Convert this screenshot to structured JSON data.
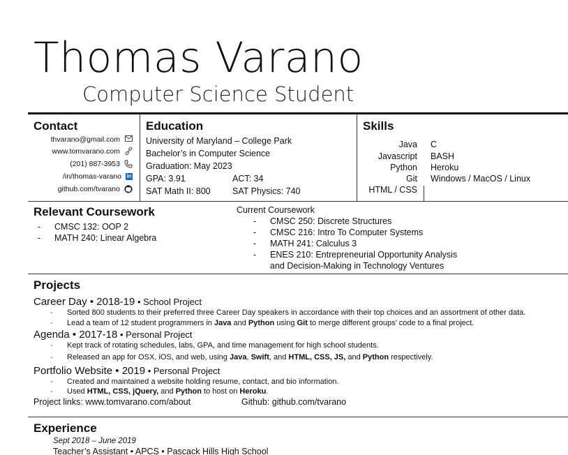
{
  "header": {
    "name": "Thomas Varano",
    "subtitle": "Computer Science Student"
  },
  "contact": {
    "heading": "Contact",
    "items": [
      {
        "text": "thvarano@gmail.com",
        "icon": "envelope-icon"
      },
      {
        "text": "www.tomvarano.com",
        "icon": "link-icon"
      },
      {
        "text": "(201) 887-3953",
        "icon": "phone-icon"
      },
      {
        "text": "/in/thomas-varano",
        "icon": "linkedin-icon"
      },
      {
        "text": "github.com/tvarano",
        "icon": "github-icon"
      }
    ]
  },
  "education": {
    "heading": "Education",
    "school": "University of Maryland – College Park",
    "degree": "Bachelor’s in Computer Science",
    "graduation": "Graduation: May 2023",
    "gpa": "GPA: 3.91",
    "act": "ACT: 34",
    "sat_math": "SAT Math II: 800",
    "sat_physics": "SAT Physics: 740"
  },
  "skills": {
    "heading": "Skills",
    "left": [
      "Java",
      "Javascript",
      "Python",
      "Git",
      "HTML / CSS"
    ],
    "right": [
      "C",
      "BASH",
      "Heroku",
      "Windows / MacOS / Linux"
    ]
  },
  "coursework": {
    "heading": "Relevant Coursework",
    "completed": [
      "CMSC 132: OOP 2",
      "MATH 240: Linear Algebra"
    ],
    "current_heading": "Current Coursework",
    "current": [
      "CMSC 250: Discrete Structures",
      "CMSC 216: Intro To Computer Systems",
      "MATH 241: Calculus 3",
      "ENES 210: Entrepreneurial Opportunity Analysis",
      "and Decision-Making in Technology Ventures"
    ]
  },
  "projects": {
    "heading": "Projects",
    "career_day": {
      "name": "Career Day",
      "sep1": " • ",
      "year": "2018-19",
      "sep2": " • ",
      "type": "School Project",
      "b1": "Sorted 800 students to their preferred three Career Day speakers in accordance with their top choices and an assortment of other data.",
      "b2_pre": "Lead a team of 12 student programmers in ",
      "b2_java": "Java",
      "b2_and": " and ",
      "b2_python": "Python",
      "b2_using": " using ",
      "b2_git": "Git",
      "b2_post": " to merge different groups’ code to a final project."
    },
    "agenda": {
      "name": "Agenda",
      "sep1": " • ",
      "year": "2017-18",
      "sep2": " • ",
      "type": "Personal Project",
      "b1": "Kept track of rotating schedules, labs, GPA, and time management for high school students.",
      "b2_pre": "Released an app for OSX, iOS, and web, using ",
      "b2_java": "Java",
      "b2_c1": ", ",
      "b2_swift": "Swift",
      "b2_c2": ", and ",
      "b2_web": "HTML, CSS, JS,",
      "b2_and": " and ",
      "b2_python": "Python",
      "b2_post": " respectively."
    },
    "portfolio": {
      "name": "Portfolio Website",
      "sep1": " • ",
      "year": "2019",
      "sep2": " • ",
      "type": "Personal Project",
      "b1": "Created and maintained a website holding resume, contact, and bio information.",
      "b2_pre": "Used ",
      "b2_tech": "HTML, CSS, jQuery,",
      "b2_and": " and ",
      "b2_python": "Python",
      "b2_mid": " to host on  ",
      "b2_heroku": "Heroku",
      "b2_post": ".",
      "links_label": "Project links: www.tomvarano.com/about",
      "github_label": "Github: github.com/tvarano"
    }
  },
  "experience": {
    "heading": "Experience",
    "dates": "Sept 2018 – June 2019",
    "role": "Teacher’s Assistant • APCS • Pascack Hills High School"
  }
}
